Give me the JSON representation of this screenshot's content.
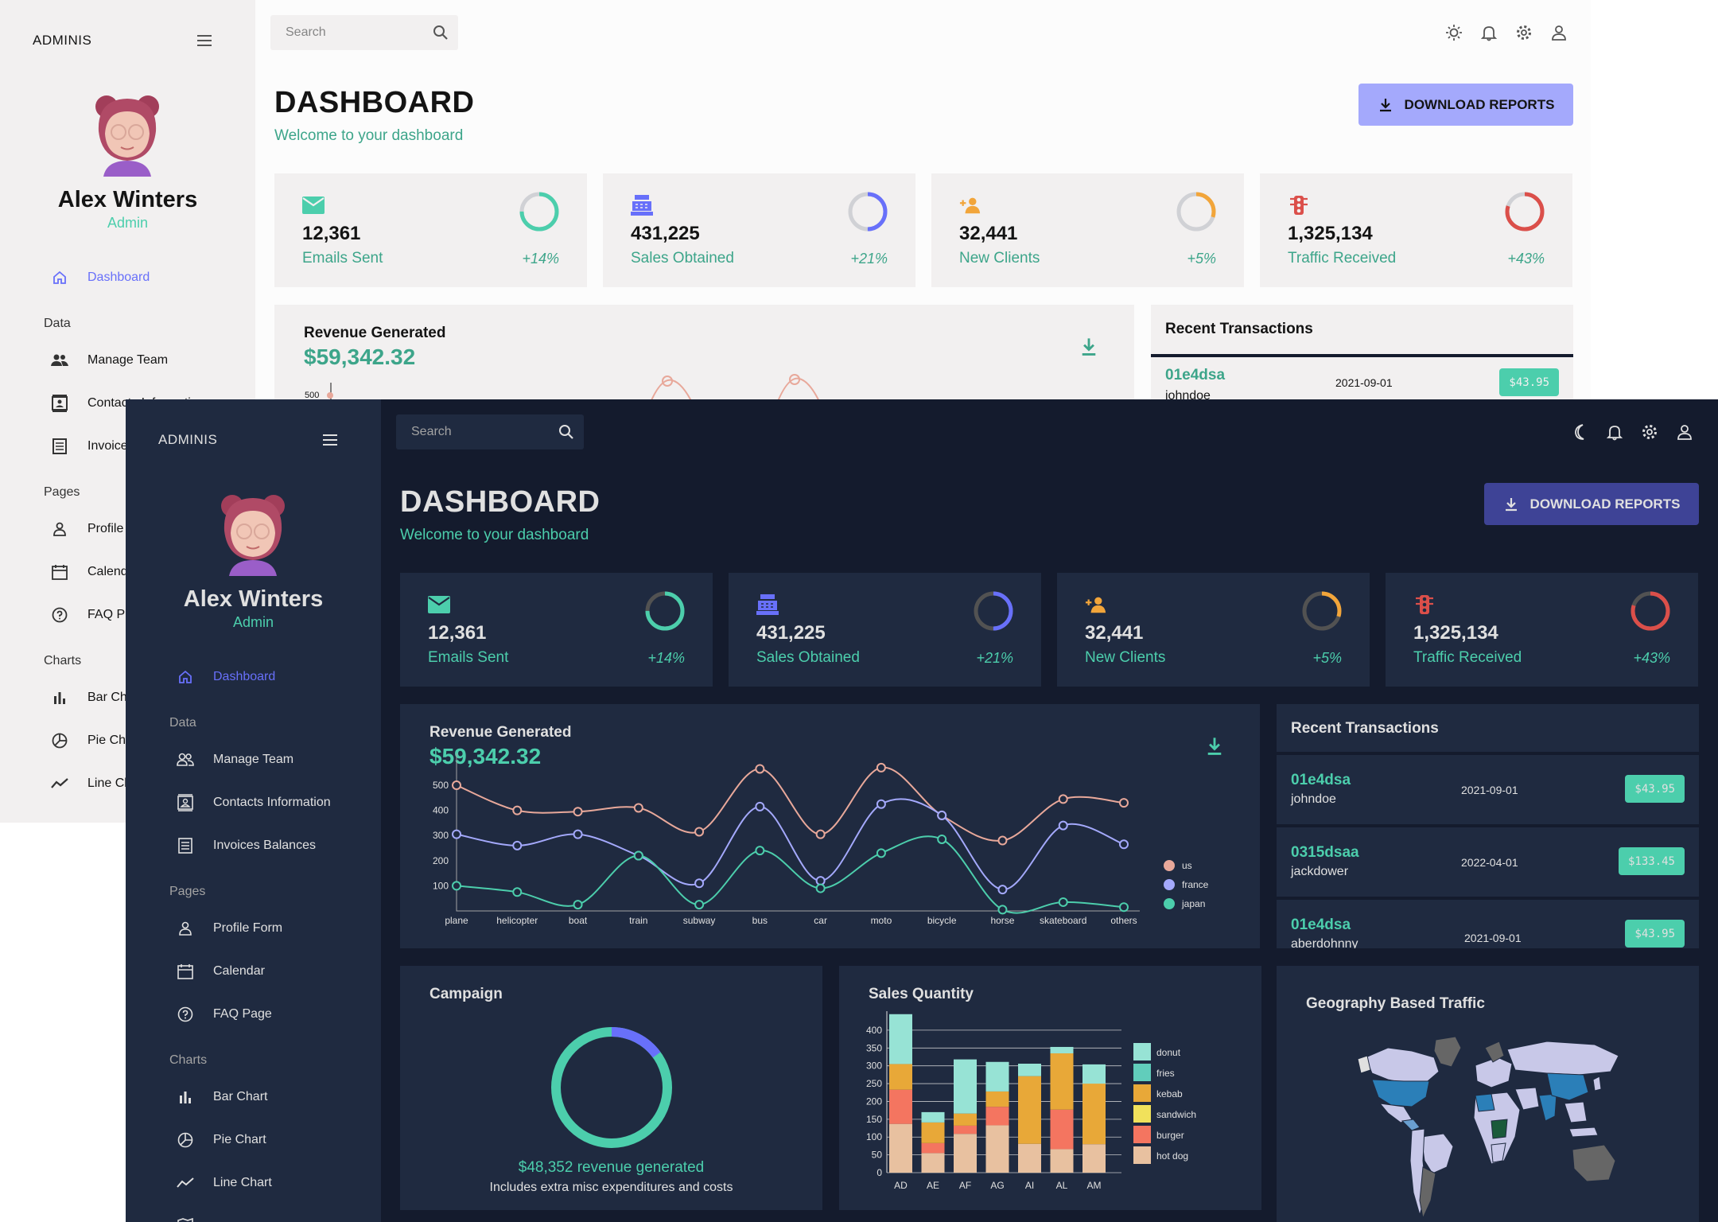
{
  "app": {
    "brand": "ADMINIS",
    "user": {
      "name": "Alex Winters",
      "role": "Admin"
    },
    "search": {
      "placeholder": "Search"
    }
  },
  "nav": {
    "dashboard": "Dashboard",
    "section_data": "Data",
    "manage_team": "Manage Team",
    "contacts": "Contacts Information",
    "invoices": "Invoices Balances",
    "section_pages": "Pages",
    "profile": "Profile Form",
    "calendar": "Calendar",
    "faq": "FAQ Page",
    "section_charts": "Charts",
    "bar": "Bar Chart",
    "pie": "Pie Chart",
    "line": "Line Chart"
  },
  "light_nav": {
    "contacts": "Contacts Information",
    "invoices": "Invoices Balances",
    "profile": "Profile",
    "calendar": "Calendar",
    "faq": "FAQ P",
    "bar": "Bar Ch",
    "pie": "Pie Ch",
    "line": "Line Ch"
  },
  "header": {
    "title": "DASHBOARD",
    "subtitle": "Welcome to your dashboard",
    "download_label": "DOWNLOAD REPORTS"
  },
  "stats": [
    {
      "value": "12,361",
      "label": "Emails Sent",
      "increase": "+14%",
      "progress": 0.75,
      "icon": "email-icon"
    },
    {
      "value": "431,225",
      "label": "Sales Obtained",
      "increase": "+21%",
      "progress": 0.5,
      "icon": "point-of-sale-icon"
    },
    {
      "value": "32,441",
      "label": "New Clients",
      "increase": "+5%",
      "progress": 0.3,
      "icon": "person-add-icon"
    },
    {
      "value": "1,325,134",
      "label": "Traffic Received",
      "increase": "+43%",
      "progress": 0.8,
      "icon": "traffic-icon"
    }
  ],
  "revenue": {
    "title": "Revenue Generated",
    "amount": "$59,342.32"
  },
  "transactions": {
    "title": "Recent Transactions",
    "items": [
      {
        "txId": "01e4dsa",
        "user": "johndoe",
        "date": "2021-09-01",
        "cost": "$43.95"
      },
      {
        "txId": "0315dsaa",
        "user": "jackdower",
        "date": "2022-04-01",
        "cost": "$133.45"
      },
      {
        "txId": "01e4dsa",
        "user": "aberdohnny",
        "date": "2021-09-01",
        "cost": "$43.95"
      }
    ]
  },
  "light_revenue_tick": "500",
  "campaign": {
    "title": "Campaign",
    "revenue_text": "$48,352 revenue generated",
    "note": "Includes extra misc expenditures and costs",
    "progress": 0.15
  },
  "sales": {
    "title": "Sales Quantity"
  },
  "geo": {
    "title": "Geography Based Traffic"
  },
  "colors": {
    "accent": "#4cceac",
    "primary": "#6870fa",
    "us": "#e8a89a",
    "france": "#a4a9fc",
    "japan": "#4cceac"
  },
  "chart_data": [
    {
      "type": "line",
      "x": [
        "plane",
        "helicopter",
        "boat",
        "train",
        "subway",
        "bus",
        "car",
        "moto",
        "bicycle",
        "horse",
        "skateboard",
        "others"
      ],
      "series": [
        {
          "name": "us",
          "values": [
            500,
            400,
            395,
            410,
            315,
            565,
            305,
            570,
            380,
            280,
            445,
            430
          ]
        },
        {
          "name": "france",
          "values": [
            305,
            260,
            305,
            220,
            110,
            415,
            120,
            425,
            380,
            85,
            340,
            265
          ]
        },
        {
          "name": "japan",
          "values": [
            100,
            75,
            25,
            220,
            25,
            240,
            90,
            230,
            285,
            5,
            35,
            15
          ]
        }
      ],
      "yticks": [
        "100",
        "200",
        "300",
        "400",
        "500"
      ],
      "legend": "right"
    },
    {
      "type": "bar",
      "categories": [
        "AD",
        "AE",
        "AF",
        "AG",
        "AI",
        "AL",
        "AM"
      ],
      "series": [
        {
          "name": "hot dog",
          "values": [
            137,
            55,
            109,
            133,
            81,
            66,
            80
          ]
        },
        {
          "name": "burger",
          "values": [
            96,
            28,
            23,
            52,
            0,
            111,
            0
          ]
        },
        {
          "name": "sandwich",
          "values": [
            0,
            0,
            0,
            0,
            0,
            0,
            0
          ]
        },
        {
          "name": "kebab",
          "values": [
            72,
            58,
            34,
            43,
            190,
            158,
            170
          ]
        },
        {
          "name": "fries",
          "values": [
            0,
            0,
            0,
            0,
            0,
            0,
            0
          ]
        },
        {
          "name": "donut",
          "values": [
            140,
            29,
            152,
            83,
            35,
            18,
            54
          ]
        }
      ],
      "yticks": [
        "0",
        "50",
        "100",
        "150",
        "200",
        "250",
        "300",
        "350",
        "400"
      ],
      "ylim": [
        0,
        440
      ],
      "stacked": true,
      "legend": "right"
    }
  ]
}
